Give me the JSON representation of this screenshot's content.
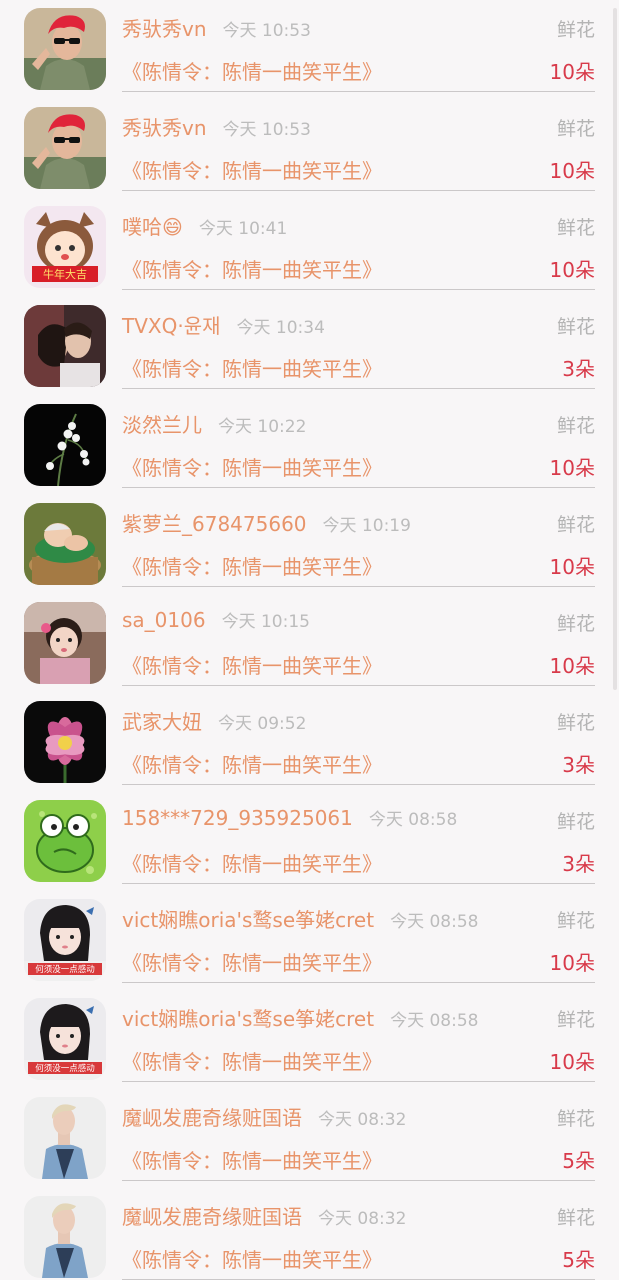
{
  "records": [
    {
      "user": "秀驮秀vn",
      "time": "今天 10:53",
      "type": "鲜花",
      "book": "《陈情令：陈情一曲笑平生》",
      "count": "10朵",
      "avatar": "red-hair-man-avatar"
    },
    {
      "user": "秀驮秀vn",
      "time": "今天 10:53",
      "type": "鲜花",
      "book": "《陈情令：陈情一曲笑平生》",
      "count": "10朵",
      "avatar": "red-hair-man-avatar"
    },
    {
      "user": "噗哈😄",
      "time": "今天 10:41",
      "type": "鲜花",
      "book": "《陈情令：陈情一曲笑平生》",
      "count": "10朵",
      "avatar": "cartoon-girl-avatar"
    },
    {
      "user": "TVXQ·윤재",
      "time": "今天 10:34",
      "type": "鲜花",
      "book": "《陈情令：陈情一曲笑平生》",
      "count": "3朵",
      "avatar": "couple-photo-avatar"
    },
    {
      "user": "淡然兰儿",
      "time": "今天 10:22",
      "type": "鲜花",
      "book": "《陈情令：陈情一曲笑平生》",
      "count": "10朵",
      "avatar": "lily-of-valley-avatar"
    },
    {
      "user": "紫萝兰_678475660",
      "time": "今天 10:19",
      "type": "鲜花",
      "book": "《陈情令：陈情一曲笑平生》",
      "count": "10朵",
      "avatar": "baby-in-basket-avatar"
    },
    {
      "user": "sa_0106",
      "time": "今天 10:15",
      "type": "鲜花",
      "book": "《陈情令：陈情一曲笑平生》",
      "count": "10朵",
      "avatar": "little-girl-avatar"
    },
    {
      "user": "武家大妞",
      "time": "今天 09:52",
      "type": "鲜花",
      "book": "《陈情令：陈情一曲笑平生》",
      "count": "3朵",
      "avatar": "lotus-flower-avatar"
    },
    {
      "user": "158***729_935925061",
      "time": "今天 08:58",
      "type": "鲜花",
      "book": "《陈情令：陈情一曲笑平生》",
      "count": "3朵",
      "avatar": "green-frog-avatar"
    },
    {
      "user": "vict娴瞧oria's鹜se筝姥cret",
      "time": "今天 08:58",
      "type": "鲜花",
      "book": "《陈情令：陈情一曲笑平生》",
      "count": "10朵",
      "avatar": "girl-caption-avatar",
      "avatar_caption": "何须没一点感动"
    },
    {
      "user": "vict娴瞧oria's鹜se筝姥cret",
      "time": "今天 08:58",
      "type": "鲜花",
      "book": "《陈情令：陈情一曲笑平生》",
      "count": "10朵",
      "avatar": "girl-caption-avatar",
      "avatar_caption": "何须没一点感动"
    },
    {
      "user": "魔岘发鹿奇缘赃国语",
      "time": "今天 08:32",
      "type": "鲜花",
      "book": "《陈情令：陈情一曲笑平生》",
      "count": "5朵",
      "avatar": "blonde-man-avatar"
    },
    {
      "user": "魔岘发鹿奇缘赃国语",
      "time": "今天 08:32",
      "type": "鲜花",
      "book": "《陈情令：陈情一曲笑平生》",
      "count": "5朵",
      "avatar": "blonde-man-avatar"
    }
  ]
}
